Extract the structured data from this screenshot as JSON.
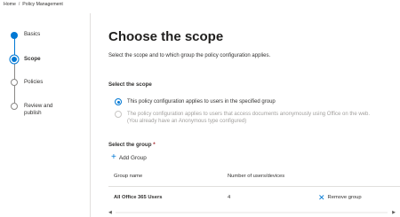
{
  "breadcrumb": {
    "home": "Home",
    "separator": "/",
    "current": "Policy Management"
  },
  "wizard": {
    "steps": [
      {
        "label": "Basics",
        "state": "done"
      },
      {
        "label": "Scope",
        "state": "current"
      },
      {
        "label": "Policies",
        "state": "todo"
      },
      {
        "label": "Review and publish",
        "state": "todo"
      }
    ]
  },
  "main": {
    "title": "Choose the scope",
    "description": "Select the scope and to which group the policy configuration applies.",
    "scope_section": {
      "label": "Select the scope",
      "options": [
        {
          "text": "This policy configuration applies to users in the specified group",
          "checked": true,
          "disabled": false
        },
        {
          "text": "The policy configuration applies to users that access documents anonymously using Office on the web.",
          "subtext": "(You already have an Anonymous type configured)",
          "checked": false,
          "disabled": true
        }
      ]
    },
    "group_section": {
      "label": "Select the group",
      "required_mark": "*",
      "add_label": "Add Group"
    },
    "table": {
      "headers": {
        "name": "Group name",
        "count": "Number of users/devices"
      },
      "rows": [
        {
          "name": "All Office 365 Users",
          "count": "4",
          "action": "Remove group"
        }
      ]
    }
  },
  "colors": {
    "accent": "#0078d4",
    "required": "#a4262c",
    "disabled": "#a19f9d"
  }
}
